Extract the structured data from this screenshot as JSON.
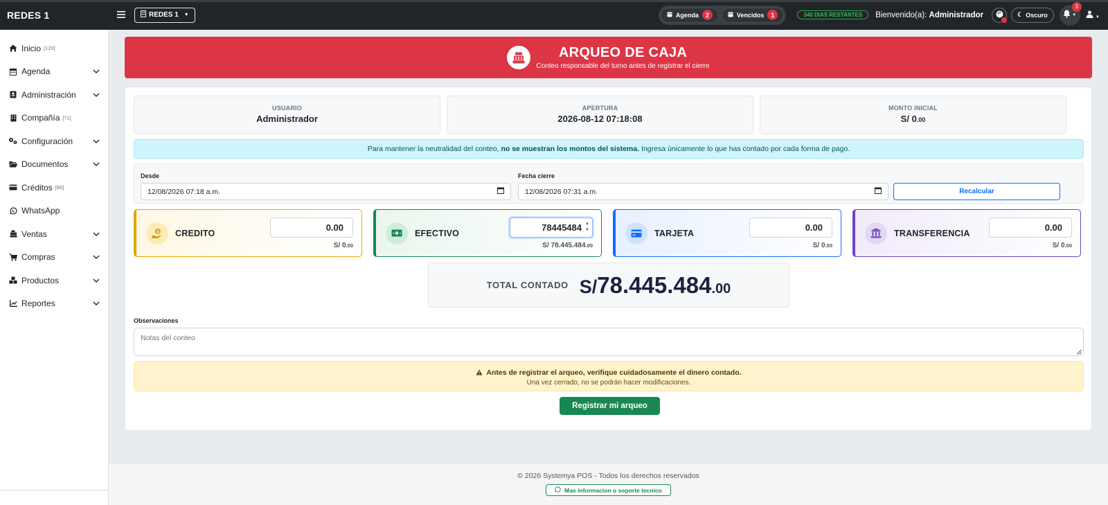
{
  "topbar": {
    "brand": "REDES 1",
    "company_selector": "REDES 1",
    "pills": [
      {
        "label": "Agenda",
        "count": "2"
      },
      {
        "label": "Vencidos",
        "count": "1"
      }
    ],
    "days_remaining": "340 DIAS RESTANTES",
    "welcome_prefix": "Bienvenido(a):",
    "welcome_user": "Administrador",
    "theme_label": "Oscuro",
    "notifications_count": "3"
  },
  "sidebar": {
    "items": [
      {
        "label": "Inicio",
        "badge": "[120]",
        "icon": "home-icon"
      },
      {
        "label": "Agenda",
        "badge": "",
        "icon": "calendar-icon",
        "expandable": true
      },
      {
        "label": "Administración",
        "badge": "",
        "icon": "id-card-icon",
        "expandable": true
      },
      {
        "label": "Compañía",
        "badge": "[71]",
        "icon": "building-icon"
      },
      {
        "label": "Configuración",
        "badge": "",
        "icon": "gears-icon",
        "expandable": true
      },
      {
        "label": "Documentos",
        "badge": "",
        "icon": "folder-open-icon",
        "expandable": true
      },
      {
        "label": "Créditos",
        "badge": "[86]",
        "icon": "credit-card-icon"
      },
      {
        "label": "WhatsApp",
        "badge": "",
        "icon": "whatsapp-icon"
      },
      {
        "label": "Ventas",
        "badge": "",
        "icon": "cash-register-icon",
        "expandable": true
      },
      {
        "label": "Compras",
        "badge": "",
        "icon": "cart-icon",
        "expandable": true
      },
      {
        "label": "Productos",
        "badge": "",
        "icon": "boxes-icon",
        "expandable": true
      },
      {
        "label": "Reportes",
        "badge": "",
        "icon": "chart-line-icon",
        "expandable": true
      }
    ]
  },
  "header": {
    "title": "ARQUEO DE CAJA",
    "subtitle": "Conteo responsable del turno antes de registrar el cierre"
  },
  "info": {
    "usuario_label": "USUARIO",
    "usuario_value": "Administrador",
    "apertura_label": "APERTURA",
    "apertura_value": "2026-08-12 07:18:08",
    "monto_label": "MONTO INICIAL",
    "monto_value": "S/ 0",
    "monto_cents": ".00"
  },
  "notice": {
    "before": "Para mantener la neutralidad del conteo,",
    "bold": "no se muestran los montos del sistema.",
    "after": "Ingresa únicamente lo que has contado por cada forma de pago."
  },
  "range": {
    "desde_label": "Desde",
    "desde_value": "12/08/2026 07:18 a.m.",
    "cierre_label": "Fecha cierre",
    "cierre_value": "12/08/2026 07:31 a.m.",
    "recalc_label": "Recalcular"
  },
  "payments": [
    {
      "name": "CREDITO",
      "input": "0.00",
      "amount": "S/ 0",
      "cents": ".00"
    },
    {
      "name": "EFECTIVO",
      "input": "78445484",
      "amount": "S/ 78.445.484",
      "cents": ".00"
    },
    {
      "name": "TARJETA",
      "input": "0.00",
      "amount": "S/ 0",
      "cents": ".00"
    },
    {
      "name": "TRANSFERENCIA",
      "input": "0.00",
      "amount": "S/ 0",
      "cents": ".00"
    }
  ],
  "total": {
    "label": "TOTAL CONTADO",
    "symbol": "S/",
    "value": "78.445.484",
    "cents": ".00"
  },
  "observaciones": {
    "label": "Observaciones",
    "placeholder": "Notas del conteo"
  },
  "warning": {
    "line1": "Antes de registrar el arqueo, verifique cuidadosamente el dinero contado.",
    "line2": "Una vez cerrado, no se podrán hacer modificaciones."
  },
  "submit_label": "Registrar mi arqueo",
  "footer": {
    "copyright": "© 2026 Systemya POS - Todos los derechos reservados",
    "support": "Mas informacion o soporte tecnico"
  },
  "colors": {
    "hero": "#dc3545",
    "credito": "#e0a800",
    "efectivo": "#198754",
    "tarjeta": "#0d6efd",
    "transferencia": "#6f42c1"
  }
}
